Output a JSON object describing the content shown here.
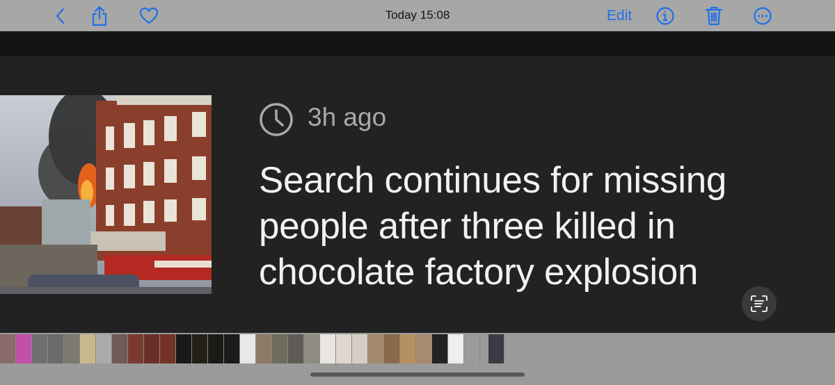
{
  "toolbar": {
    "title": "Today  15:08",
    "edit_label": "Edit",
    "icons": [
      "back-chevron-icon",
      "share-icon",
      "heart-icon",
      "info-icon",
      "trash-icon",
      "more-icon"
    ],
    "accent_color": "#1f6fe8"
  },
  "article": {
    "age": "3h ago",
    "headline": "Search continues for missing people after three killed in chocolate factory explosion"
  },
  "filmstrip": {
    "thumbnail_colors": [
      "#8a6a6a",
      "#c24fa8",
      "#707070",
      "#6a6a6a",
      "#7c7a70",
      "#c8b98d",
      "#aaaaaa",
      "#6f5a57",
      "#7a3a30",
      "#6a3028",
      "#743226",
      "#1a1a1a",
      "#232018",
      "#1c1a16",
      "#1b1b1b",
      "#e8e8e8",
      "#8a7a66",
      "#6e6a5d",
      "#5f5c55",
      "#8f8b80",
      "#e9e5e0",
      "#e0d8d0",
      "#d6cdc4",
      "#a48a6a",
      "#8a6a4a",
      "#b69060",
      "#a88a70",
      "#222222",
      "#eeeeee",
      "#9b9b9b",
      "#3b3b45"
    ]
  }
}
